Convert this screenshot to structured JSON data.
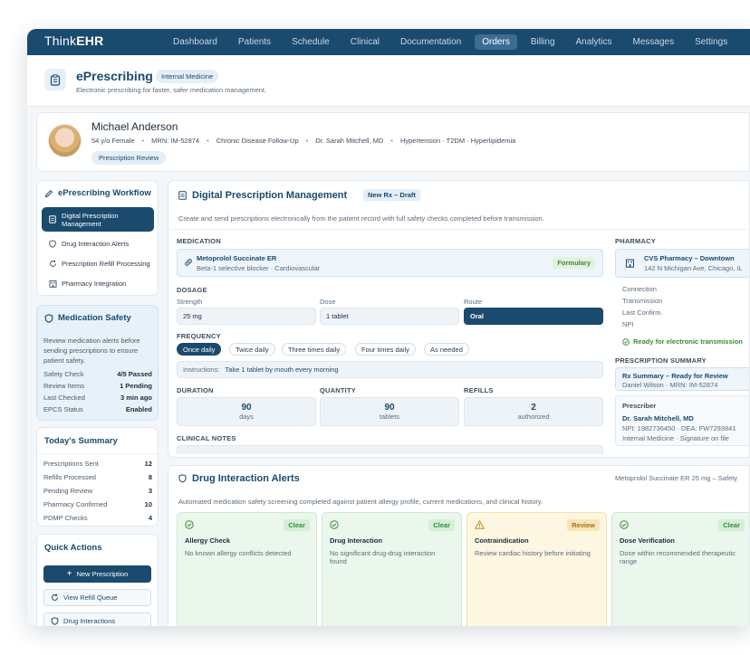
{
  "app": {
    "logo_light": "Think",
    "logo_bold": "EHR"
  },
  "nav": [
    "Dashboard",
    "Patients",
    "Schedule",
    "Clinical",
    "Documentation",
    "Orders",
    "Billing",
    "Analytics",
    "Messages",
    "Settings"
  ],
  "nav_active": "Orders",
  "page": {
    "title": "ePrescribing",
    "badge": "Internal Medicine",
    "subtitle": "Electronic prescribing for faster, safer medication management."
  },
  "patient": {
    "name": "Michael Anderson",
    "age_sex": "54 y/o Female",
    "mrn": "MRN: IM-52874",
    "visit": "Chronic Disease Follow-Up",
    "provider": "Dr. Sarah Mitchell, MD",
    "conditions": "Hypertension · T2DM · Hyperlipidemia",
    "status": "Prescription Review"
  },
  "workflow": {
    "title": "ePrescribing Workflow",
    "items": [
      "Digital Prescription Management",
      "Drug Interaction Alerts",
      "Prescription Refill Processing",
      "Pharmacy Integration"
    ]
  },
  "safety": {
    "title": "Medication Safety",
    "desc": "Review medication alerts before sending prescriptions to ensure patient safety.",
    "rows": [
      {
        "k": "Safety Check",
        "v": "4/5 Passed"
      },
      {
        "k": "Review Items",
        "v": "1 Pending"
      },
      {
        "k": "Last Checked",
        "v": "3 min ago"
      },
      {
        "k": "EPCS Status",
        "v": "Enabled"
      }
    ]
  },
  "summary": {
    "title": "Today's Summary",
    "rows": [
      {
        "k": "Prescriptions Sent",
        "v": "12"
      },
      {
        "k": "Refills Processed",
        "v": "8"
      },
      {
        "k": "Pending Review",
        "v": "3"
      },
      {
        "k": "Pharmacy Confirmed",
        "v": "10"
      },
      {
        "k": "PDMP Checks",
        "v": "4"
      }
    ]
  },
  "quick": {
    "title": "Quick Actions",
    "new_rx": "New Prescription",
    "refill": "View Refill Queue",
    "interactions": "Drug Interactions"
  },
  "dpm": {
    "title": "Digital Prescription Management",
    "badge": "New Rx – Draft",
    "subtitle": "Create and send prescriptions electronically from the patient record with full safety checks completed before transmission.",
    "medication_label": "MEDICATION",
    "med_name": "Metoprolol Succinate ER",
    "med_desc": "Beta-1 selective blocker · Cardiovascular",
    "formulary": "Formulary",
    "dosage_label": "DOSAGE",
    "strength_label": "Strength",
    "strength": "25 mg",
    "dose_label": "Dose",
    "dose": "1 tablet",
    "route_label": "Route",
    "route": "Oral",
    "frequency_label": "FREQUENCY",
    "frequencies": [
      "Once daily",
      "Twice daily",
      "Three times daily",
      "Four times daily",
      "As needed"
    ],
    "instructions_label": "Instructions:",
    "instructions": "Take 1 tablet by mouth every morning",
    "duration_label": "DURATION",
    "duration": "90",
    "duration_unit": "days",
    "quantity_label": "QUANTITY",
    "quantity": "90",
    "quantity_unit": "tablets",
    "refills_label": "REFILLS",
    "refills": "2",
    "refills_unit": "authorized",
    "notes_label": "CLINICAL NOTES"
  },
  "pharmacy": {
    "label": "PHARMACY",
    "name": "CVS Pharmacy – Downtown",
    "address": "142 N Michigan Ave, Chicago, IL",
    "fields": [
      "Connection",
      "Transmission",
      "Last Confirm.",
      "NPI"
    ],
    "ready": "Ready for electronic transmission",
    "rx_summary_label": "PRESCRIPTION SUMMARY",
    "rx_summary_title": "Rx Summary – Ready for Review",
    "rx_summary_patient": "Daniel Wilson · MRN: IM-52874",
    "prescriber_label": "Prescriber",
    "prescriber_name": "Dr. Sarah Mitchell, MD",
    "prescriber_ids": "NPI: 1982736450 · DEA: FW7293841",
    "prescriber_dept": "Internal Medicine · Signature on file"
  },
  "dia": {
    "title": "Drug Interaction Alerts",
    "right": "Metoprolol Succinate ER 25 mg – Safety",
    "subtitle": "Automated medication safety screening completed against patient allergy profile, current medications, and clinical history.",
    "cards": [
      {
        "title": "Allergy Check",
        "status": "Clear",
        "desc": "No known allergy conflicts detected"
      },
      {
        "title": "Drug Interaction",
        "status": "Clear",
        "desc": "No significant drug-drug interaction found"
      },
      {
        "title": "Contraindication",
        "status": "Review",
        "desc": "Review cardiac history before initiating"
      },
      {
        "title": "Dose Verification",
        "status": "Clear",
        "desc": "Dose within recommended therapeutic range"
      }
    ]
  },
  "colors": {
    "primary": "#1a4a6d",
    "success": "#3a8a3a",
    "warning": "#a9711a",
    "page_bg": "#f3f7fa"
  }
}
